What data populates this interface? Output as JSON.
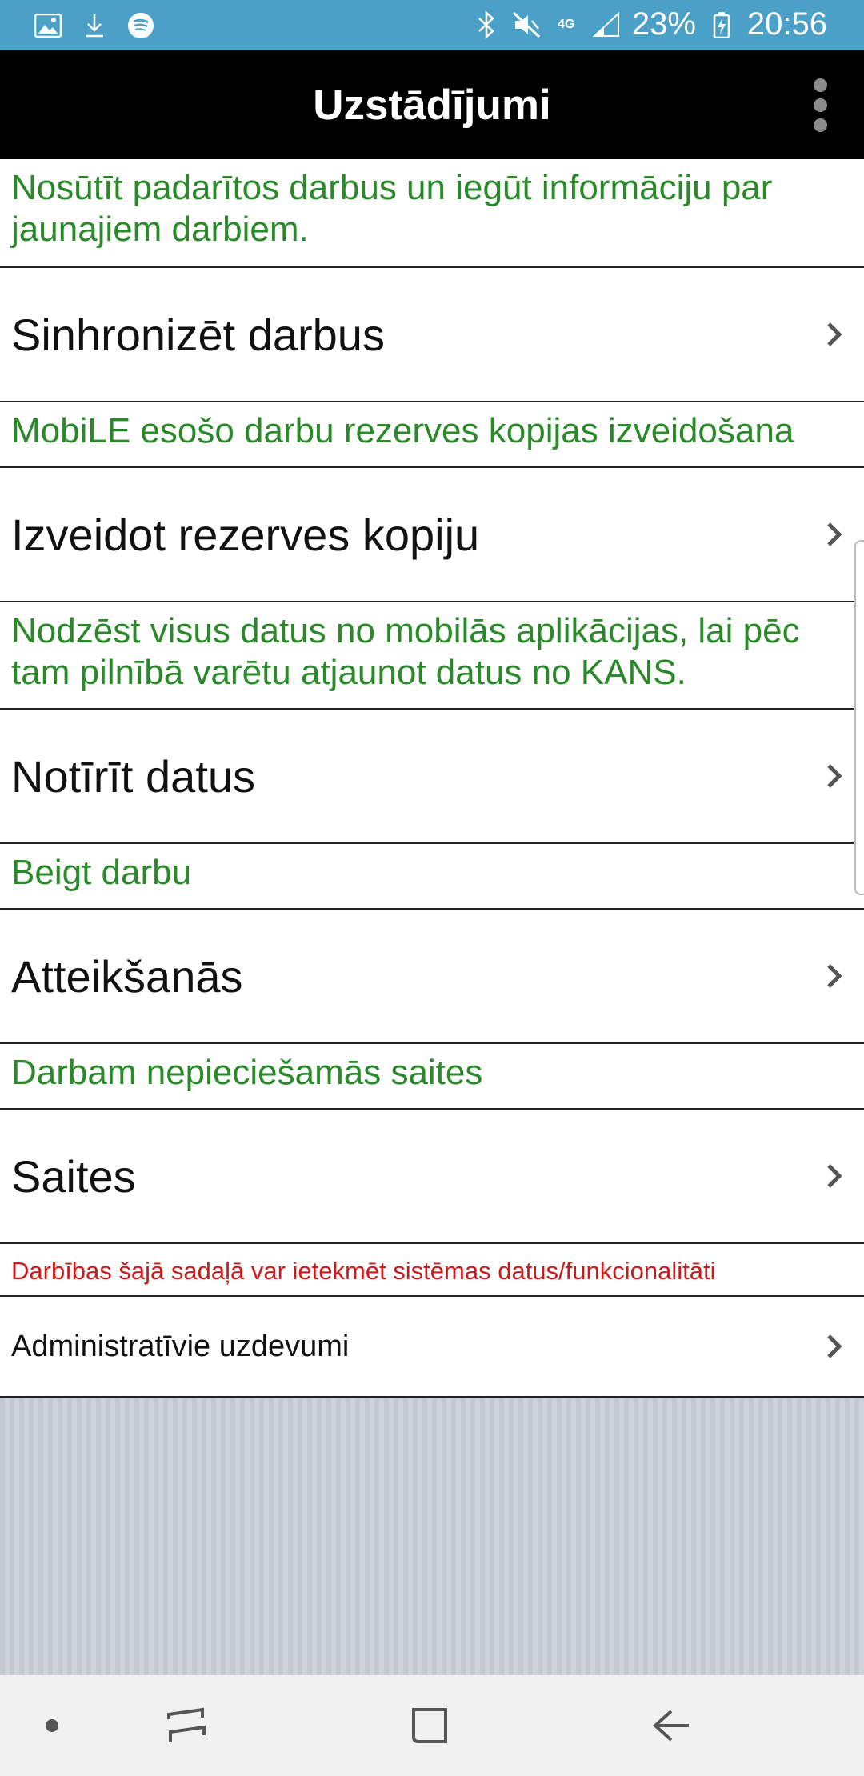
{
  "status_bar": {
    "battery": "23%",
    "time": "20:56",
    "network": "4G",
    "icons_left": [
      "image-icon",
      "download-icon",
      "spotify-icon"
    ],
    "icons_right": [
      "bluetooth-icon",
      "mute-icon",
      "signal-icon",
      "battery-icon"
    ]
  },
  "app_bar": {
    "title": "Uzstādījumi",
    "menu_icon": "overflow-menu-icon"
  },
  "sections": [
    {
      "hint": "Nosūtīt padarītos darbus un iegūt informāciju par jaunajiem darbiem.",
      "label": "Sinhronizēt darbus"
    },
    {
      "hint": "MobiLE esošo darbu rezerves kopijas izveidošana",
      "label": "Izveidot rezerves kopiju"
    },
    {
      "hint": "Nodzēst visus datus no mobilās aplikācijas, lai pēc tam pilnībā varētu atjaunot datus no KANS.",
      "label": "Notīrīt datus"
    },
    {
      "hint": "Beigt darbu",
      "label": "Atteikšanās"
    },
    {
      "hint": "Darbam nepieciešamās saites",
      "label": "Saites"
    }
  ],
  "admin": {
    "warning": "Darbības šajā sadaļā var ietekmēt sistēmas datus/funkcionalitāti",
    "label": "Administratīvie uzdevumi"
  },
  "colors": {
    "status_bar": "#4aa0c6",
    "app_bar": "#000000",
    "hint_text": "#2a8a2a",
    "warning_text": "#cc1a1a"
  },
  "nav_bar": {
    "icons": [
      "dot-icon",
      "recents-icon",
      "home-icon",
      "back-icon"
    ]
  }
}
